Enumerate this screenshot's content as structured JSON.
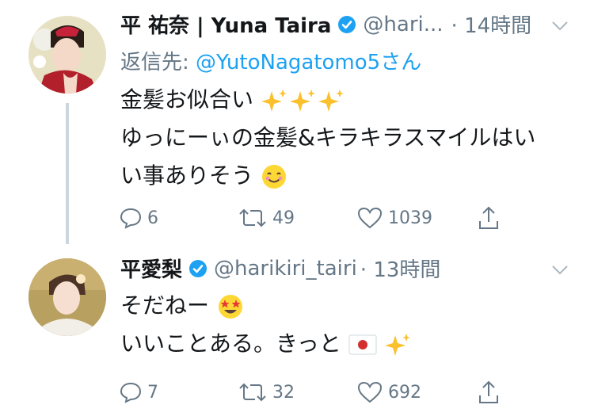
{
  "tweets": [
    {
      "name": "平 祐奈 | Yuna Taira",
      "handle": "@hari...",
      "time": "· 14時間",
      "reply_to_prefix": "返信先: ",
      "reply_to_mention": "@YutoNagatomo5さん",
      "lines": [
        "金髪お似合い",
        "ゆっにーぃの金髪&キラキラスマイルはい",
        "い事ありそう"
      ],
      "replies": "6",
      "retweets": "49",
      "likes": "1039"
    },
    {
      "name": "平愛梨",
      "handle": "@harikiri_tairi",
      "time": "· 13時間",
      "lines": [
        "そだねー",
        "いいことある。きっと"
      ],
      "replies": "7",
      "retweets": "32",
      "likes": "692"
    }
  ],
  "colors": {
    "text": "#14171a",
    "secondary": "#657786",
    "link": "#1da1f2",
    "thread": "#ccd6dd",
    "verified": "#1da1f2"
  }
}
